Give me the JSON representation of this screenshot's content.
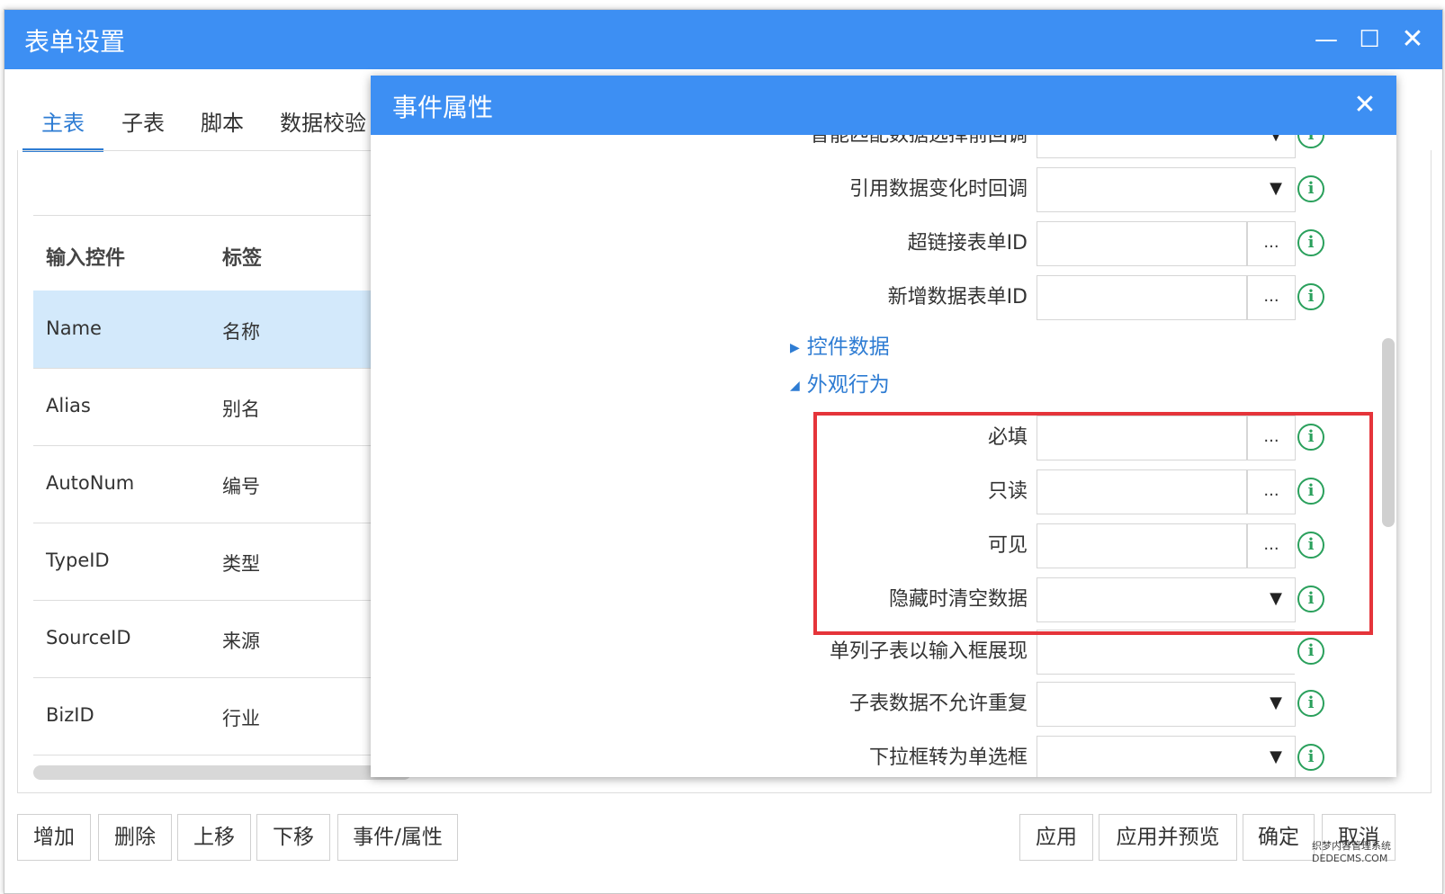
{
  "outer_dialog": {
    "title": "表单设置",
    "window_buttons": {
      "minimize": "—",
      "maximize": "☐",
      "close": "✕"
    },
    "tabs": [
      "主表",
      "子表",
      "脚本",
      "数据校验"
    ],
    "active_tab": "主表",
    "list": {
      "headers": [
        "输入控件",
        "标签"
      ],
      "rows": [
        {
          "control": "Name",
          "label": "名称",
          "selected": true
        },
        {
          "control": "Alias",
          "label": "别名"
        },
        {
          "control": "AutoNum",
          "label": "编号"
        },
        {
          "control": "TypeID",
          "label": "类型"
        },
        {
          "control": "SourceID",
          "label": "来源"
        },
        {
          "control": "BizID",
          "label": "行业"
        }
      ]
    },
    "bottom_left_buttons": [
      "增加",
      "删除",
      "上移",
      "下移",
      "事件/属性"
    ],
    "bottom_right_buttons": [
      "应用",
      "应用并预览",
      "确定",
      "取消"
    ]
  },
  "inner_dialog": {
    "title": "事件属性",
    "close": "✕",
    "rows_top": [
      {
        "label": "智能匹配数据选择前回调",
        "type": "dropdown"
      },
      {
        "label": "引用数据变化时回调",
        "type": "dropdown"
      },
      {
        "label": "超链接表单ID",
        "type": "ellipsis"
      },
      {
        "label": "新增数据表单ID",
        "type": "ellipsis"
      }
    ],
    "sections": [
      {
        "label": "控件数据",
        "expanded": false,
        "arrow": "▶"
      },
      {
        "label": "外观行为",
        "expanded": true,
        "arrow": "◢"
      }
    ],
    "rows_bottom": [
      {
        "label": "必填",
        "type": "ellipsis"
      },
      {
        "label": "只读",
        "type": "ellipsis"
      },
      {
        "label": "可见",
        "type": "ellipsis"
      },
      {
        "label": "隐藏时清空数据",
        "type": "dropdown"
      },
      {
        "label": "单列子表以输入框展现",
        "type": "text"
      },
      {
        "label": "子表数据不允许重复",
        "type": "dropdown"
      },
      {
        "label": "下拉框转为单选框",
        "type": "dropdown"
      }
    ],
    "ellipsis_text": "...",
    "dropdown_arrow": "▼",
    "info_icon": "i"
  },
  "colors": {
    "header_blue": "#3d8ff3",
    "tab_active": "#2e7cd3",
    "selected_row": "#d3e9fb",
    "info_green": "#2aa05c",
    "highlight_red": "#e5343a"
  },
  "watermark": [
    "织梦内容管理系统",
    "DEDECMS.COM"
  ]
}
